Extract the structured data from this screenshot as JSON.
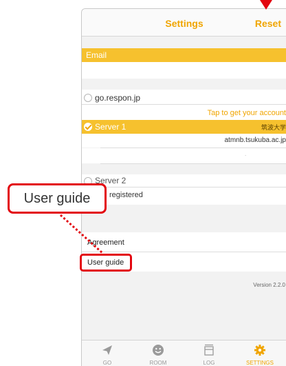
{
  "nav": {
    "title": "Settings",
    "reset_label": "Reset"
  },
  "email": {
    "header": "Email",
    "value": ""
  },
  "options": {
    "go_respon": "go.respon.jp",
    "tap_account": "Tap to get your account",
    "server1": "Server 1",
    "server1_university": "筑波大学",
    "server1_host": "atmnb.tsukuba.ac.jp",
    "server1_extra": ".",
    "server2": "Server 2",
    "server2_status": "registered"
  },
  "links": {
    "agreement": "Agreement",
    "user_guide": "User guide"
  },
  "version": "Version 2.2.0",
  "tabs": [
    {
      "label": "GO",
      "icon": "paper-plane-icon"
    },
    {
      "label": "ROOM",
      "icon": "smiley-icon"
    },
    {
      "label": "LOG",
      "icon": "log-icon"
    },
    {
      "label": "SETTINGS",
      "icon": "gear-icon",
      "active": true
    }
  ],
  "annotation": {
    "callout_text": "User guide"
  },
  "colors": {
    "accent": "#f0a500",
    "section": "#f6c12e",
    "highlight": "#e3060f"
  }
}
